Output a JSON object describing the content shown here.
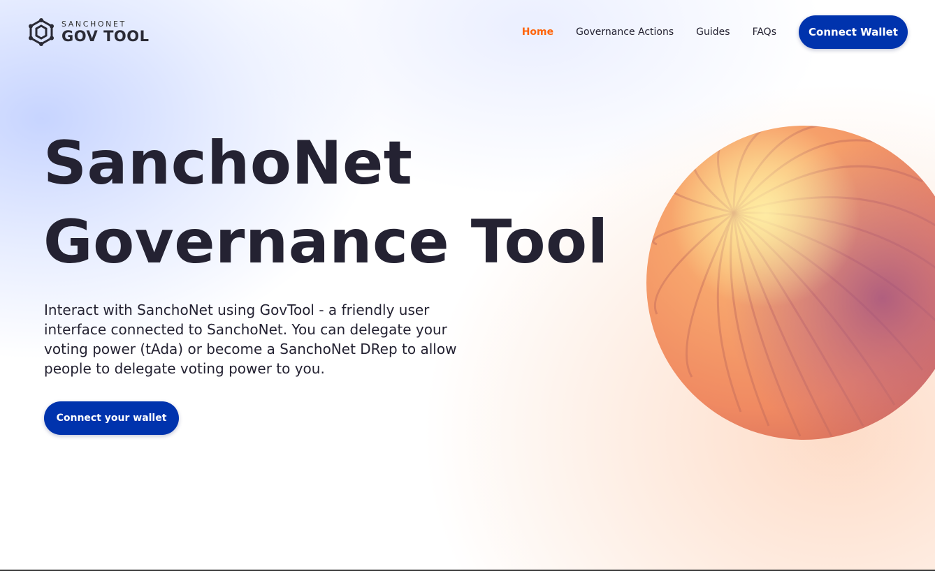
{
  "header": {
    "logo": {
      "small_text": "SANCHONET",
      "big_text": "GOV TOOL",
      "icon": "govtool-hexagon-logo-icon"
    },
    "nav": {
      "items": [
        {
          "label": "Home",
          "active": true
        },
        {
          "label": "Governance Actions",
          "active": false
        },
        {
          "label": "Guides",
          "active": false
        },
        {
          "label": "FAQs",
          "active": false
        }
      ],
      "connect_label": "Connect Wallet"
    }
  },
  "hero": {
    "title_line_1": "SanchoNet",
    "title_line_2": "Governance Tool",
    "description": "Interact with SanchoNet using GovTool - a friendly user interface connected to SanchoNet. You can delegate your voting power (tAda) or become a SanchoNet DRep to allow people to delegate voting power to you.",
    "cta_label": "Connect your wallet",
    "illustration": "orange-ribbed-sphere-illustration"
  },
  "colors": {
    "accent_active": "#ff640a",
    "primary_button": "#0033ad",
    "text": "#242232",
    "sphere_orange": "#f4976a",
    "sphere_purple": "#b9637e"
  }
}
